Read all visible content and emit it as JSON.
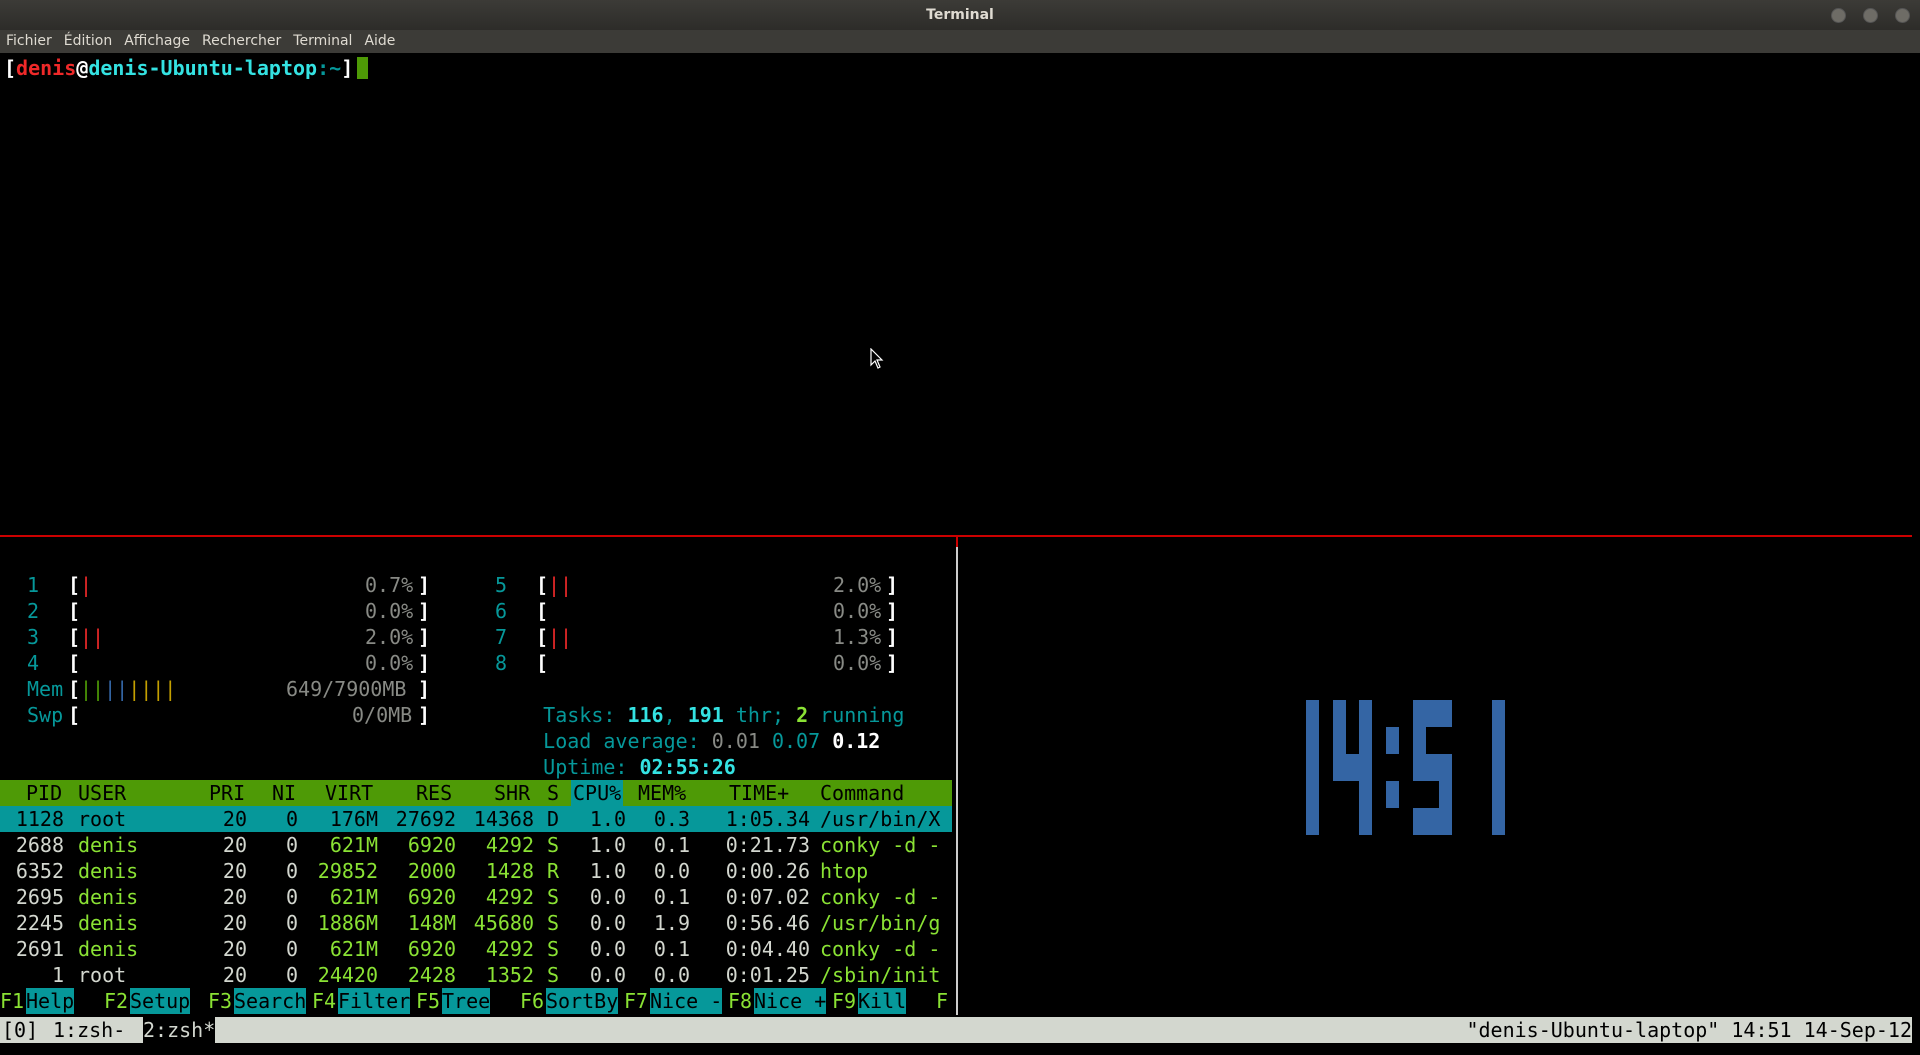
{
  "window": {
    "title": "Terminal"
  },
  "menubar": {
    "items": [
      "Fichier",
      "Édition",
      "Affichage",
      "Rechercher",
      "Terminal",
      "Aide"
    ]
  },
  "prompt": {
    "open": "[",
    "user": "denis",
    "at": "@",
    "host": "denis-Ubuntu-laptop",
    "path": ":~",
    "close": "]"
  },
  "htop": {
    "cpus": [
      {
        "num": "1",
        "bars": "|",
        "pct": "0.7%"
      },
      {
        "num": "2",
        "bars": "",
        "pct": "0.0%"
      },
      {
        "num": "3",
        "bars": "||",
        "pct": "2.0%"
      },
      {
        "num": "4",
        "bars": "",
        "pct": "0.0%"
      },
      {
        "num": "5",
        "bars": "||",
        "pct": "2.0%"
      },
      {
        "num": "6",
        "bars": "",
        "pct": "0.0%"
      },
      {
        "num": "7",
        "bars": "||",
        "pct": "1.3%"
      },
      {
        "num": "8",
        "bars": "",
        "pct": "0.0%"
      }
    ],
    "mem": {
      "label": "Mem",
      "bars": "||||||||",
      "value": "649/7900MB"
    },
    "swp": {
      "label": "Swp",
      "bars": "",
      "value": "0/0MB"
    },
    "tasks": {
      "label": "Tasks: ",
      "tasks": "116",
      "sep": ", ",
      "thr": "191",
      "thr_label": " thr; ",
      "running": "2",
      "running_label": " running"
    },
    "load": {
      "label": "Load average: ",
      "l1": "0.01",
      "l5": "0.07",
      "l15": "0.12"
    },
    "uptime": {
      "label": "Uptime: ",
      "value": "02:55:26"
    },
    "columns": [
      "PID",
      "USER",
      "PRI",
      "NI",
      "VIRT",
      "RES",
      "SHR",
      "S",
      "CPU%",
      "MEM%",
      "TIME+",
      "Command"
    ],
    "processes": [
      {
        "pid": "1128",
        "user": "root",
        "pri": "20",
        "ni": "0",
        "virt": "176M",
        "res": "27692",
        "shr": "14368",
        "s": "D",
        "cpu": "1.0",
        "mem": "0.3",
        "time": "1:05.34",
        "cmd": "/usr/bin/X"
      },
      {
        "pid": "2688",
        "user": "denis",
        "pri": "20",
        "ni": "0",
        "virt": "621M",
        "res": "6920",
        "shr": "4292",
        "s": "S",
        "cpu": "1.0",
        "mem": "0.1",
        "time": "0:21.73",
        "cmd": "conky -d -"
      },
      {
        "pid": "6352",
        "user": "denis",
        "pri": "20",
        "ni": "0",
        "virt": "29852",
        "res": "2000",
        "shr": "1428",
        "s": "R",
        "cpu": "1.0",
        "mem": "0.0",
        "time": "0:00.26",
        "cmd": "htop"
      },
      {
        "pid": "2695",
        "user": "denis",
        "pri": "20",
        "ni": "0",
        "virt": "621M",
        "res": "6920",
        "shr": "4292",
        "s": "S",
        "cpu": "0.0",
        "mem": "0.1",
        "time": "0:07.02",
        "cmd": "conky -d -"
      },
      {
        "pid": "2245",
        "user": "denis",
        "pri": "20",
        "ni": "0",
        "virt": "1886M",
        "res": "148M",
        "shr": "45680",
        "s": "S",
        "cpu": "0.0",
        "mem": "1.9",
        "time": "0:56.46",
        "cmd": "/usr/bin/g"
      },
      {
        "pid": "2691",
        "user": "denis",
        "pri": "20",
        "ni": "0",
        "virt": "621M",
        "res": "6920",
        "shr": "4292",
        "s": "S",
        "cpu": "0.0",
        "mem": "0.1",
        "time": "0:04.40",
        "cmd": "conky -d -"
      },
      {
        "pid": "1",
        "user": "root",
        "pri": "20",
        "ni": "0",
        "virt": "24420",
        "res": "2428",
        "shr": "1352",
        "s": "S",
        "cpu": "0.0",
        "mem": "0.0",
        "time": "0:01.25",
        "cmd": "/sbin/init"
      }
    ],
    "fkeys": [
      {
        "key": "F1",
        "label": "Help  "
      },
      {
        "key": "F2",
        "label": "Setup "
      },
      {
        "key": "F3",
        "label": "Search"
      },
      {
        "key": "F4",
        "label": "Filter"
      },
      {
        "key": "F5",
        "label": "Tree  "
      },
      {
        "key": "F6",
        "label": "SortBy"
      },
      {
        "key": "F7",
        "label": "Nice -"
      },
      {
        "key": "F8",
        "label": "Nice +"
      },
      {
        "key": "F9",
        "label": "Kill  "
      },
      {
        "key": "F",
        "label": ""
      }
    ]
  },
  "clock": {
    "time": "14:51",
    "color": "#3465a4"
  },
  "tmux": {
    "session": "[0]",
    "windows": [
      {
        "label": "1:zsh-",
        "current": false
      },
      {
        "label": "2:zsh*",
        "current": true
      }
    ],
    "status_right": "\"denis-Ubuntu-laptop\" 14:51 14-Sep-12"
  }
}
